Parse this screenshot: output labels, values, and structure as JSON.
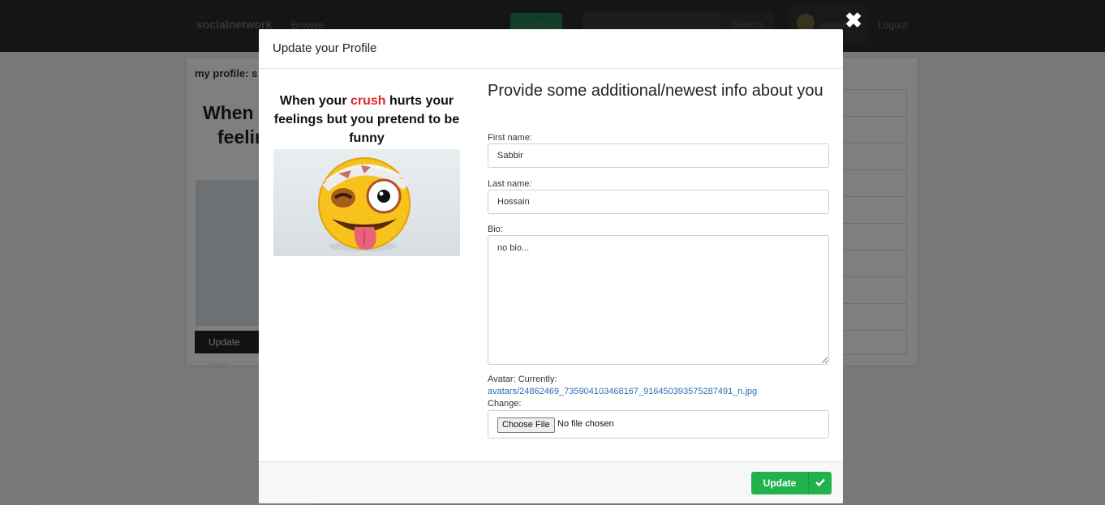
{
  "nav": {
    "brand": "socialnetwork",
    "browse": "Browse",
    "friends": "Friends ▾",
    "search_placeholder": "Search all posts",
    "search_button": "Search",
    "username": "sabbir",
    "logout": "Logout"
  },
  "background": {
    "profile_label": "my profile: s",
    "meme_text_line1": "When",
    "meme_text_line2": "feelin",
    "update_button": "Update your"
  },
  "modal": {
    "title": "Update your Profile",
    "close_glyph": "✖",
    "meme": {
      "caption_part1": "When your ",
      "caption_highlight": "crush",
      "caption_part2": " hurts your feelings but you pretend to be funny"
    },
    "form": {
      "heading": "Provide some additional/newest info about you",
      "first_name_label": "First name:",
      "first_name_value": "Sabbir",
      "last_name_label": "Last name:",
      "last_name_value": "Hossain",
      "bio_label": "Bio:",
      "bio_value": "no bio...",
      "avatar_label": "Avatar: Currently:",
      "avatar_link": "avatars/24862469_735904103468167_916450393575287491_n.jpg",
      "change_label": "Change:",
      "choose_file": "Choose File",
      "no_file": "No file chosen"
    },
    "footer": {
      "update_button": "Update",
      "update_icon": "check-icon"
    }
  },
  "colors": {
    "accent_green": "#22b24c",
    "link_blue": "#2a6db0",
    "crush_red": "#e0262a"
  }
}
